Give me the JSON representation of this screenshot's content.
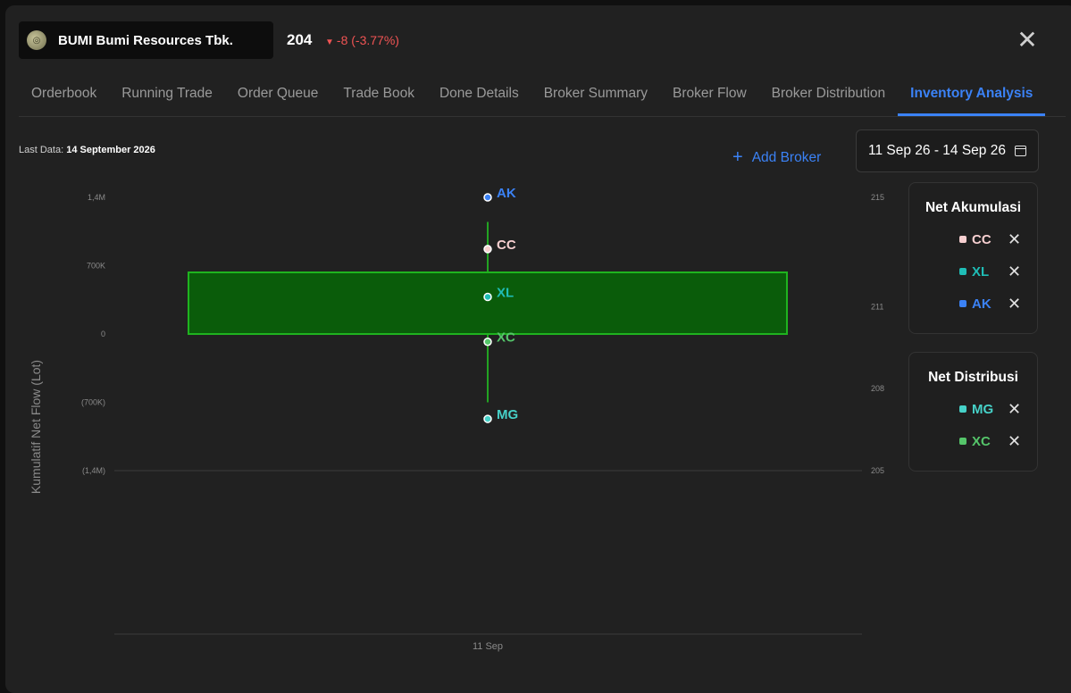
{
  "header": {
    "ticker_name": "BUMI Bumi Resources Tbk.",
    "price": "204",
    "change": "-8 (-3.77%)",
    "close_icon": "close-icon",
    "logo_icon": "company-logo"
  },
  "tabs": [
    {
      "label": "Orderbook"
    },
    {
      "label": "Running Trade"
    },
    {
      "label": "Order Queue"
    },
    {
      "label": "Trade Book"
    },
    {
      "label": "Done Details"
    },
    {
      "label": "Broker Summary"
    },
    {
      "label": "Broker Flow"
    },
    {
      "label": "Broker Distribution"
    },
    {
      "label": "Inventory Analysis",
      "active": true
    }
  ],
  "toolbar": {
    "last_data_label": "Last Data:",
    "last_data_value": "14 September 2026",
    "add_broker": "Add Broker",
    "date_range": "11 Sep 26 - 14 Sep 26"
  },
  "legend": {
    "accumulation_title": "Net Akumulasi",
    "accumulation": [
      {
        "code": "CC",
        "color": "#f7cfd0"
      },
      {
        "code": "XL",
        "color": "#1fbdb6"
      },
      {
        "code": "AK",
        "color": "#3b82f6"
      }
    ],
    "distribution_title": "Net Distribusi",
    "distribution": [
      {
        "code": "MG",
        "color": "#46d1c8"
      },
      {
        "code": "XC",
        "color": "#55c56a"
      }
    ]
  },
  "chart_data": {
    "type": "scatter",
    "ylabel": "Kumulatif Net Flow (Lot)",
    "x_categories": [
      "11 Sep"
    ],
    "y_ticks": [
      "1,4M",
      "700K",
      "0",
      "(700K)",
      "(1,4M)"
    ],
    "y_tick_values": [
      1400000,
      700000,
      0,
      -700000,
      -1400000
    ],
    "y2_ticks": [
      "215",
      "211",
      "208",
      "205"
    ],
    "y2_tick_values": [
      215,
      211,
      208,
      205
    ],
    "candle": {
      "open": 211,
      "close": 209.2,
      "high": 214.1,
      "low": 207.5,
      "color": "#0a5c0a"
    },
    "series": [
      {
        "name": "AK",
        "x": "11 Sep",
        "y": 1400000,
        "color": "#3b82f6",
        "label": "AK"
      },
      {
        "name": "CC",
        "x": "11 Sep",
        "y": 870000,
        "color": "#f7cfd0",
        "label": "CC"
      },
      {
        "name": "XL",
        "x": "11 Sep",
        "y": 380000,
        "color": "#1fbdb6",
        "label": "XL"
      },
      {
        "name": "XC",
        "x": "11 Sep",
        "y": -80000,
        "color": "#55c56a",
        "label": "XC"
      },
      {
        "name": "MG",
        "x": "11 Sep",
        "y": -870000,
        "color": "#46d1c8",
        "label": "MG"
      }
    ]
  }
}
